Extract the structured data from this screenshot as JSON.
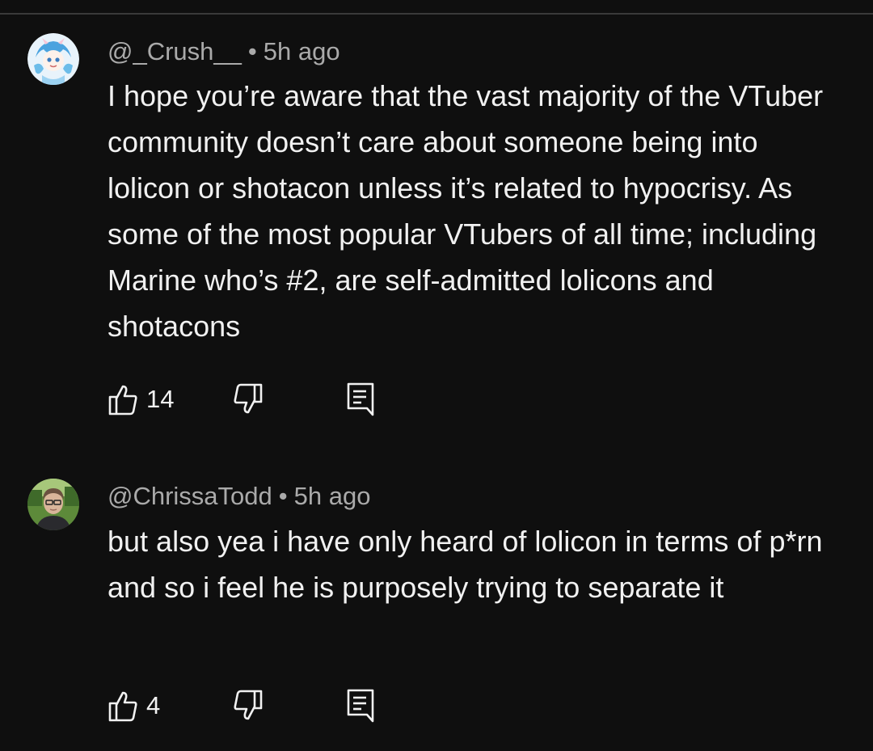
{
  "comments": [
    {
      "handle": "@_Crush__",
      "separator": "•",
      "time": "5h ago",
      "text": "I hope you’re aware that the vast majority of the VTuber community doesn’t care about someone being into lolicon or shotacon unless it’s related to hypocrisy. As some of the most popular VTubers of all time; including Marine who’s #2, are self-admitted lolicons and shotacons",
      "likes": "14",
      "avatar_icon": "anime-character-avatar"
    },
    {
      "handle": "@ChrissaTodd",
      "separator": "•",
      "time": "5h ago",
      "text": "but also yea i have only heard of lolicon in terms of p*rn and so i feel he is purposely trying to separate it",
      "likes": "4",
      "avatar_icon": "person-photo-avatar"
    }
  ],
  "icons": {
    "like": "thumbs-up-icon",
    "dislike": "thumbs-down-icon",
    "reply": "reply-comment-icon"
  },
  "colors": {
    "background": "#0f0f0f",
    "primary_text": "#f1f1f1",
    "secondary_text": "#aaaaaa"
  }
}
